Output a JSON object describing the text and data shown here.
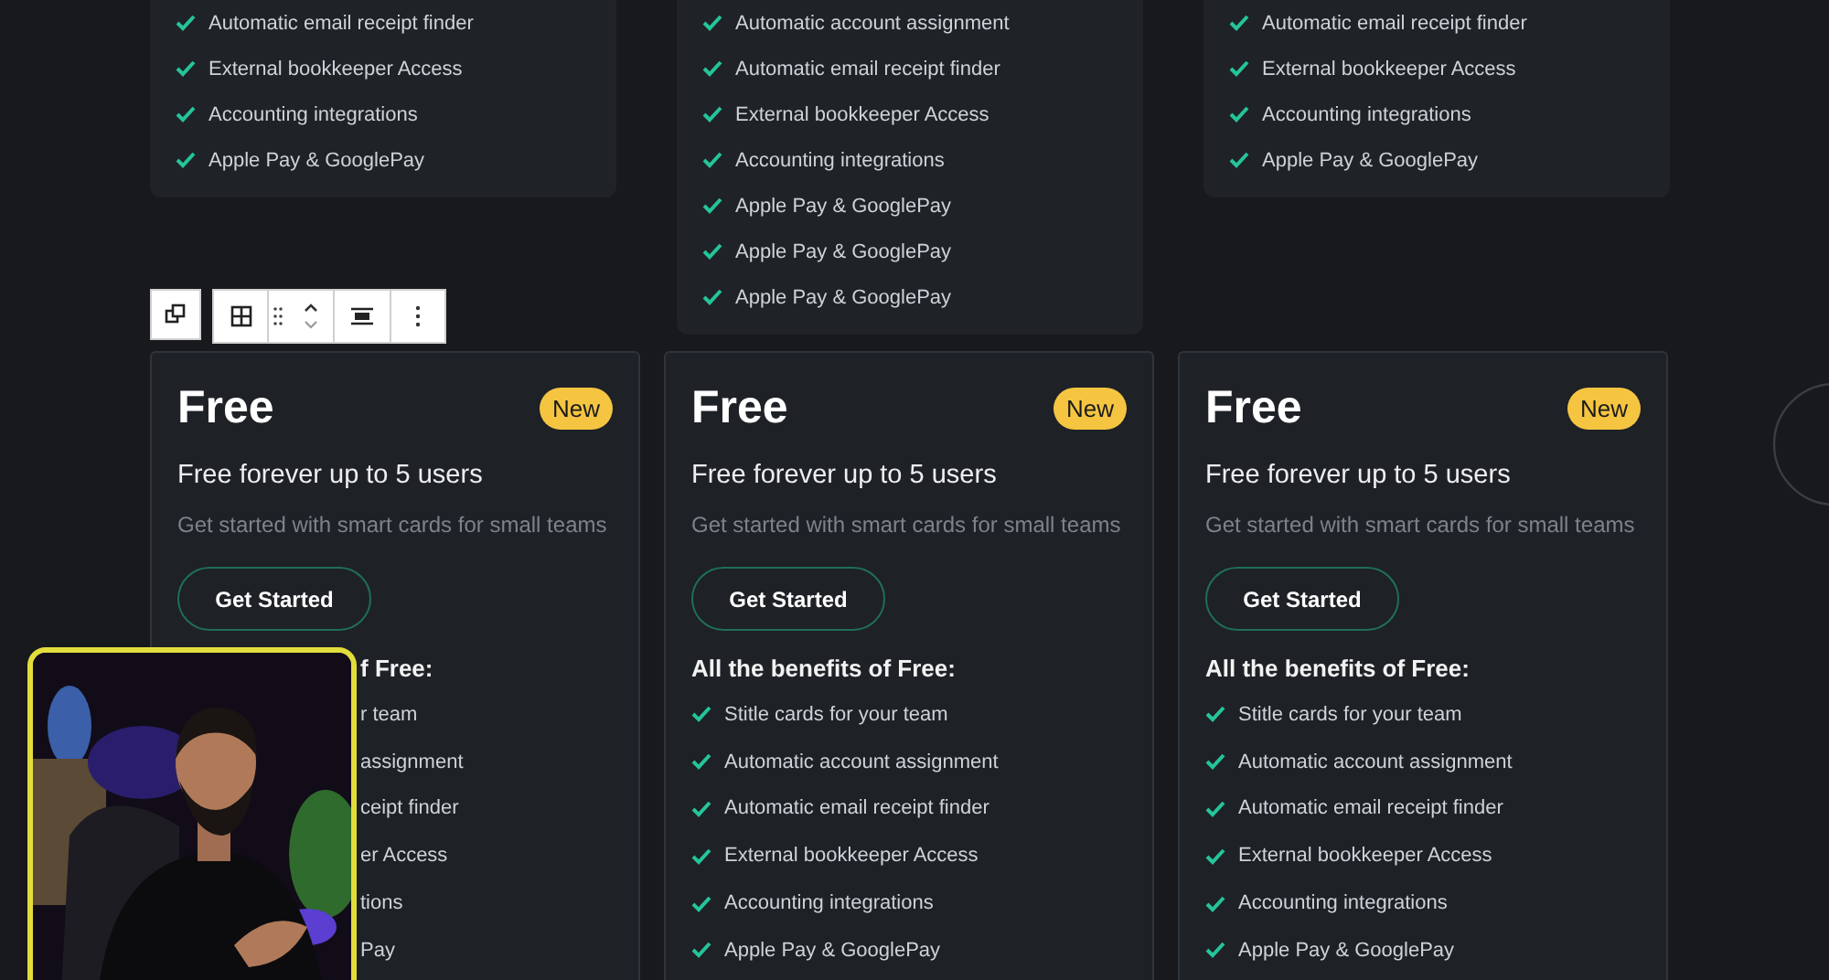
{
  "top_cards": [
    {
      "features": [
        "Automatic email receipt finder",
        "External bookkeeper Access",
        "Accounting integrations",
        "Apple Pay & GooglePay"
      ]
    },
    {
      "features": [
        "Automatic account assignment",
        "Automatic email receipt finder",
        "External bookkeeper Access",
        "Accounting integrations",
        "Apple Pay & GooglePay",
        "Apple Pay & GooglePay",
        "Apple Pay & GooglePay"
      ]
    },
    {
      "features": [
        "Automatic email receipt finder",
        "External bookkeeper Access",
        "Accounting integrations",
        "Apple Pay & GooglePay"
      ]
    }
  ],
  "pricing_cards": [
    {
      "title": "Free",
      "badge": "New",
      "subtitle": "Free forever up to 5 users",
      "description": "Get started with smart cards for small teams",
      "button": "Get Started",
      "benefits_heading": "f Free:",
      "obscured": true,
      "features": [
        "r team",
        "assignment",
        "ceipt finder",
        "er Access",
        "tions",
        "Pay"
      ]
    },
    {
      "title": "Free",
      "badge": "New",
      "subtitle": "Free forever up to 5 users",
      "description": "Get started with smart cards for small teams",
      "button": "Get Started",
      "benefits_heading": "All the benefits of Free:",
      "obscured": false,
      "features": [
        "Stitle cards for your team",
        "Automatic account assignment",
        "Automatic email receipt finder",
        "External bookkeeper Access",
        "Accounting integrations",
        "Apple Pay & GooglePay"
      ]
    },
    {
      "title": "Free",
      "badge": "New",
      "subtitle": "Free forever up to 5 users",
      "description": "Get started with smart cards for small teams",
      "button": "Get Started",
      "benefits_heading": "All the benefits of Free:",
      "obscured": false,
      "features": [
        "Stitle cards for your team",
        "Automatic account assignment",
        "Automatic email receipt finder",
        "External bookkeeper Access",
        "Accounting integrations",
        "Apple Pay & GooglePay"
      ]
    }
  ]
}
